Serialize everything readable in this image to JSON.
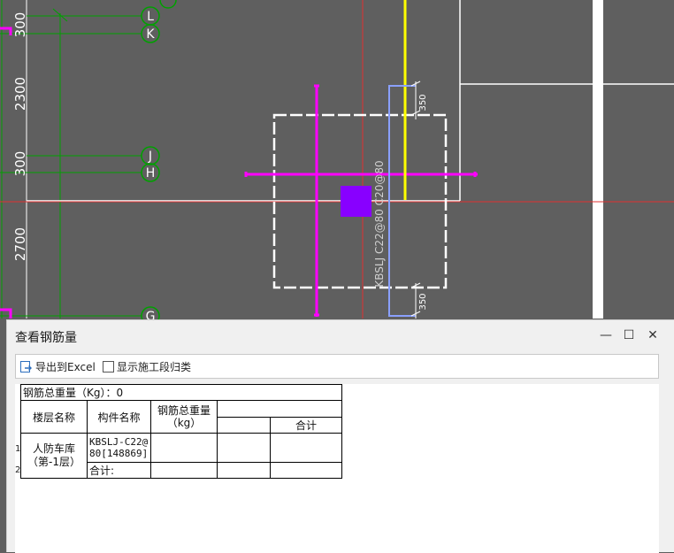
{
  "drawing": {
    "dimensions": [
      "300",
      "2300",
      "300",
      "2700"
    ],
    "axis_labels": [
      "L",
      "K",
      "J",
      "H",
      "G"
    ],
    "rebar_label": "KBSLJ C22@80 C20@80",
    "offset_dims": [
      "350",
      "350"
    ],
    "colors": {
      "background": "#5f5f5f",
      "axis_line": "#00a000",
      "wall": "#ffffff",
      "magenta": "#ff00ff",
      "yellow": "#ffff00",
      "blue": "#8899ff",
      "red": "#e03030",
      "purple": "#8800ff"
    }
  },
  "dialog": {
    "title": "查看钢筋量",
    "controls": {
      "minimize": "—",
      "maximize": "☐",
      "close": "✕"
    },
    "toolbar": {
      "export_label": "导出到Excel",
      "export_icon": "excel-export-icon",
      "checkbox_label": "显示施工段归类",
      "checkbox_checked": false
    },
    "table": {
      "total_label": "钢筋总重量（Kg）：0",
      "headers": {
        "floor": "楼层名称",
        "component": "构件名称",
        "total_weight": "钢筋总重量（kg）",
        "sum": "合计"
      },
      "rows": [
        {
          "index": "1",
          "floor": "人防车库（第-1层）",
          "component": "KBSLJ-C22@80[148869]",
          "weight": "",
          "col4": "",
          "sum": ""
        },
        {
          "index": "2",
          "floor": "",
          "component": "合计:",
          "weight": "",
          "col4": "",
          "sum": ""
        }
      ]
    }
  }
}
